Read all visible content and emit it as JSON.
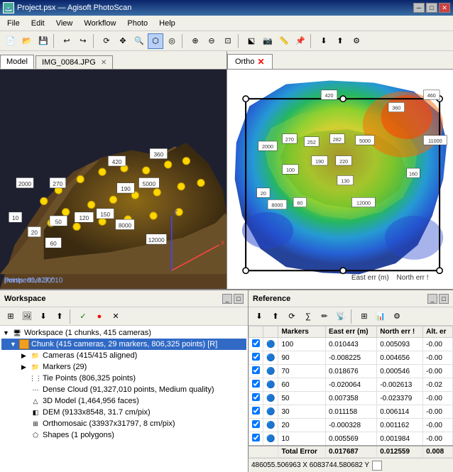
{
  "window": {
    "title": "Project.psx — Agisoft PhotoScan"
  },
  "titlebar": {
    "minimize": "─",
    "maximize": "□",
    "close": "✕"
  },
  "menu": {
    "items": [
      "File",
      "Edit",
      "View",
      "Workflow",
      "Photo",
      "Help"
    ]
  },
  "left_panel": {
    "tabs": [
      {
        "label": "Model",
        "active": true
      },
      {
        "label": "IMG_0084.JPG",
        "active": false,
        "closable": true
      }
    ],
    "perspective_label": "Perspective 30°",
    "points_label": "points: 91,327,010"
  },
  "right_panel": {
    "tab_label": "Ortho",
    "markers": {
      "numbers": [
        "420",
        "460",
        "360",
        "2000",
        "270",
        "252",
        "282",
        "5000",
        "11000",
        "190",
        "220",
        "100",
        "130",
        "160",
        "20",
        "8000",
        "60",
        "12000"
      ]
    }
  },
  "workspace": {
    "title": "Workspace",
    "root_label": "Workspace (1 chunks, 415 cameras)",
    "chunk": {
      "label": "Chunk (415 cameras, 29 markers, 806,325 points) [R]",
      "cameras_label": "Cameras (415/415 aligned)",
      "markers_label": "Markers (29)",
      "tiepoints_label": "Tie Points (806,325 points)",
      "densecloud_label": "Dense Cloud (91,327,010 points, Medium quality)",
      "model_label": "3D Model (1,464,956 faces)",
      "dem_label": "DEM (9133x8548, 31.7 cm/pix)",
      "ortho_label": "Orthomosaic (33937x31797, 8 cm/pix)",
      "shapes_label": "Shapes (1 polygons)"
    }
  },
  "reference": {
    "title": "Reference",
    "columns": [
      "",
      "",
      "Markers",
      "East err (m)",
      "North err !",
      "Alt. er"
    ],
    "rows": [
      {
        "enabled": true,
        "marker": "100",
        "east": "0.010443",
        "north": "0.005093",
        "alt": "-0.00"
      },
      {
        "enabled": true,
        "marker": "90",
        "east": "-0.008225",
        "north": "0.004656",
        "alt": "-0.00"
      },
      {
        "enabled": true,
        "marker": "70",
        "east": "0.018676",
        "north": "0.000546",
        "alt": "-0.00"
      },
      {
        "enabled": true,
        "marker": "60",
        "east": "-0.020064",
        "north": "-0.002613",
        "alt": "-0.02"
      },
      {
        "enabled": true,
        "marker": "50",
        "east": "0.007358",
        "north": "-0.023379",
        "alt": "-0.00"
      },
      {
        "enabled": true,
        "marker": "30",
        "east": "0.011158",
        "north": "0.006114",
        "alt": "-0.00"
      },
      {
        "enabled": true,
        "marker": "20",
        "east": "-0.000328",
        "north": "0.001162",
        "alt": "-0.00"
      },
      {
        "enabled": true,
        "marker": "10",
        "east": "0.005569",
        "north": "0.001984",
        "alt": "-0.00"
      }
    ],
    "total": {
      "label": "Total Error",
      "east": "0.017687",
      "north": "0.012559",
      "alt": "0.008"
    },
    "coord_bar": "486055.506963 X  6083744.580682 Y"
  }
}
